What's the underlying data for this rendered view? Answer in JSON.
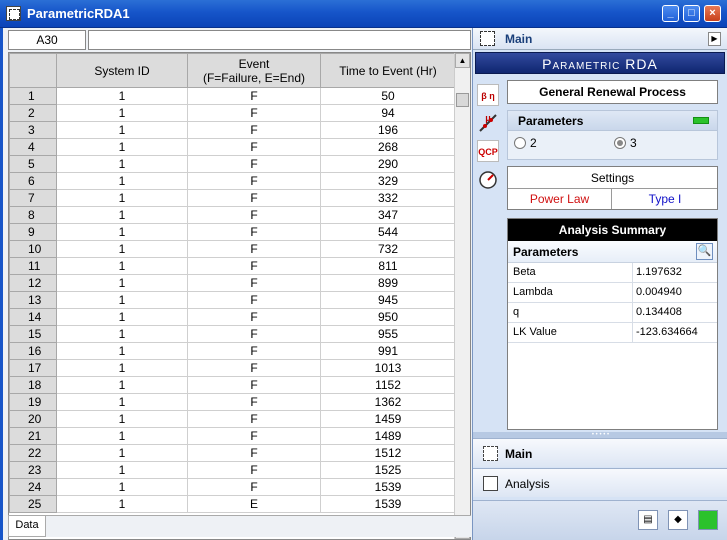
{
  "window": {
    "title": "ParametricRDA1"
  },
  "cellbar": {
    "reference": "A30",
    "formula": ""
  },
  "grid": {
    "headers": [
      "System ID",
      "Event\n(F=Failure, E=End)",
      "Time to Event (Hr)"
    ],
    "rows": [
      {
        "num": "1",
        "system": "1",
        "event": "F",
        "time": "50"
      },
      {
        "num": "2",
        "system": "1",
        "event": "F",
        "time": "94"
      },
      {
        "num": "3",
        "system": "1",
        "event": "F",
        "time": "196"
      },
      {
        "num": "4",
        "system": "1",
        "event": "F",
        "time": "268"
      },
      {
        "num": "5",
        "system": "1",
        "event": "F",
        "time": "290"
      },
      {
        "num": "6",
        "system": "1",
        "event": "F",
        "time": "329"
      },
      {
        "num": "7",
        "system": "1",
        "event": "F",
        "time": "332"
      },
      {
        "num": "8",
        "system": "1",
        "event": "F",
        "time": "347"
      },
      {
        "num": "9",
        "system": "1",
        "event": "F",
        "time": "544"
      },
      {
        "num": "10",
        "system": "1",
        "event": "F",
        "time": "732"
      },
      {
        "num": "11",
        "system": "1",
        "event": "F",
        "time": "811"
      },
      {
        "num": "12",
        "system": "1",
        "event": "F",
        "time": "899"
      },
      {
        "num": "13",
        "system": "1",
        "event": "F",
        "time": "945"
      },
      {
        "num": "14",
        "system": "1",
        "event": "F",
        "time": "950"
      },
      {
        "num": "15",
        "system": "1",
        "event": "F",
        "time": "955"
      },
      {
        "num": "16",
        "system": "1",
        "event": "F",
        "time": "991"
      },
      {
        "num": "17",
        "system": "1",
        "event": "F",
        "time": "1013"
      },
      {
        "num": "18",
        "system": "1",
        "event": "F",
        "time": "1152"
      },
      {
        "num": "19",
        "system": "1",
        "event": "F",
        "time": "1362"
      },
      {
        "num": "20",
        "system": "1",
        "event": "F",
        "time": "1459"
      },
      {
        "num": "21",
        "system": "1",
        "event": "F",
        "time": "1489"
      },
      {
        "num": "22",
        "system": "1",
        "event": "F",
        "time": "1512"
      },
      {
        "num": "23",
        "system": "1",
        "event": "F",
        "time": "1525"
      },
      {
        "num": "24",
        "system": "1",
        "event": "F",
        "time": "1539"
      },
      {
        "num": "25",
        "system": "1",
        "event": "E",
        "time": "1539"
      }
    ]
  },
  "sheet_tabs": [
    "Data"
  ],
  "panel": {
    "header": "Main",
    "banner": "Parametric RDA",
    "process": "General Renewal Process",
    "parameters": {
      "label": "Parameters",
      "options": [
        "2",
        "3"
      ],
      "selected": "3"
    },
    "settings": {
      "label": "Settings",
      "model": "Power Law",
      "type": "Type I"
    },
    "summary": {
      "title": "Analysis Summary",
      "section": "Parameters",
      "rows": [
        {
          "name": "Beta",
          "value": "1.197632"
        },
        {
          "name": "Lambda",
          "value": "0.004940"
        },
        {
          "name": "q",
          "value": "0.134408"
        },
        {
          "name": "LK Value",
          "value": "-123.634664"
        }
      ]
    },
    "nav": [
      {
        "label": "Main"
      },
      {
        "label": "Analysis"
      }
    ],
    "colors": {
      "accent": "#1655c9",
      "banner": "#1a2f80",
      "power_law": "#d01010",
      "type": "#1010c8",
      "toggle": "#2bc22b"
    }
  },
  "icons": [
    "app-icon",
    "minimize-icon",
    "maximize-icon",
    "close-icon",
    "main-icon",
    "chevron-right-icon",
    "parameters-icon",
    "plot-icon",
    "qcp-icon",
    "gauge-icon",
    "magnify-icon",
    "analysis-icon",
    "report-icon",
    "calculate-icon",
    "toggle-icon"
  ],
  "tool_labels": {
    "parameters": "β η μ",
    "qcp": "QCP"
  },
  "window_buttons": {
    "minimize": "_",
    "maximize": "□",
    "close": "×"
  }
}
